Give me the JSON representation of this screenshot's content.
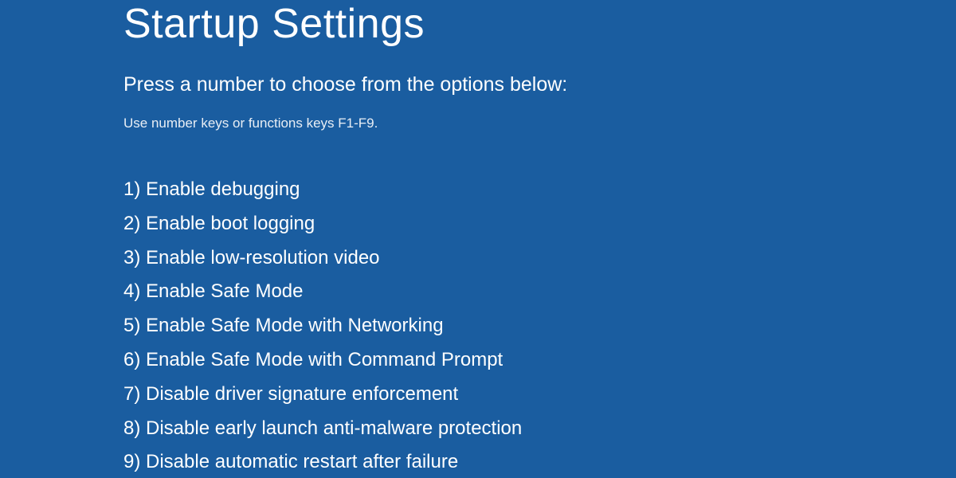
{
  "title": "Startup Settings",
  "instruction": "Press a number to choose from the options below:",
  "hint": "Use number keys or functions keys F1-F9.",
  "options": [
    "1) Enable debugging",
    "2) Enable boot logging",
    "3) Enable low-resolution video",
    "4) Enable Safe Mode",
    "5) Enable Safe Mode with Networking",
    "6) Enable Safe Mode with Command Prompt",
    "7) Disable driver signature enforcement",
    "8) Disable early launch anti-malware protection",
    "9) Disable automatic restart after failure"
  ]
}
